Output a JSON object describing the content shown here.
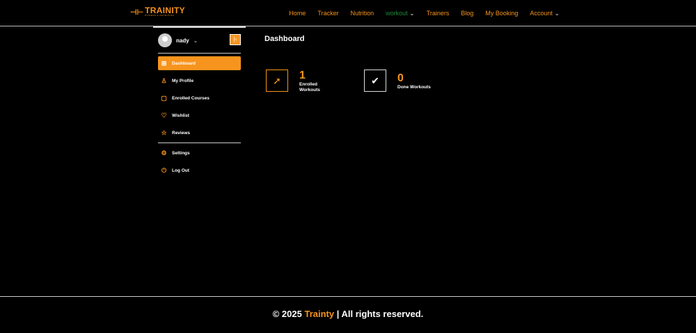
{
  "brand": {
    "name": "TRAINITY",
    "tagline": "FITNESS & NUTRITION"
  },
  "nav": {
    "items": [
      "Home",
      "Tracker",
      "Nutrition",
      "workout",
      "Trainers",
      "Blog",
      "My Booking",
      "Account"
    ]
  },
  "sidebar": {
    "user": "nady",
    "items": [
      {
        "label": "Dashboard",
        "icon": "grid-icon"
      },
      {
        "label": "My Profile",
        "icon": "user-icon"
      },
      {
        "label": "Enrolled Courses",
        "icon": "courses-icon"
      },
      {
        "label": "Wishlist",
        "icon": "heart-icon"
      },
      {
        "label": "Reviews",
        "icon": "star-icon"
      },
      {
        "label": "Settings",
        "icon": "gear-icon"
      },
      {
        "label": "Log Out",
        "icon": "power-icon"
      }
    ]
  },
  "main": {
    "title": "Dashboard",
    "stats": [
      {
        "value": "1",
        "label": "Enrolled Workouts",
        "label1": "Enrolled",
        "label2": "Workouts"
      },
      {
        "value": "0",
        "label": "Done Workouts"
      }
    ]
  },
  "footer": {
    "prefix": "© 2025",
    "brand": "Trainty",
    "suffix": "| All rights reserved."
  },
  "colors": {
    "accent": "#f7941d",
    "active_nav": "#1e8a3a"
  }
}
